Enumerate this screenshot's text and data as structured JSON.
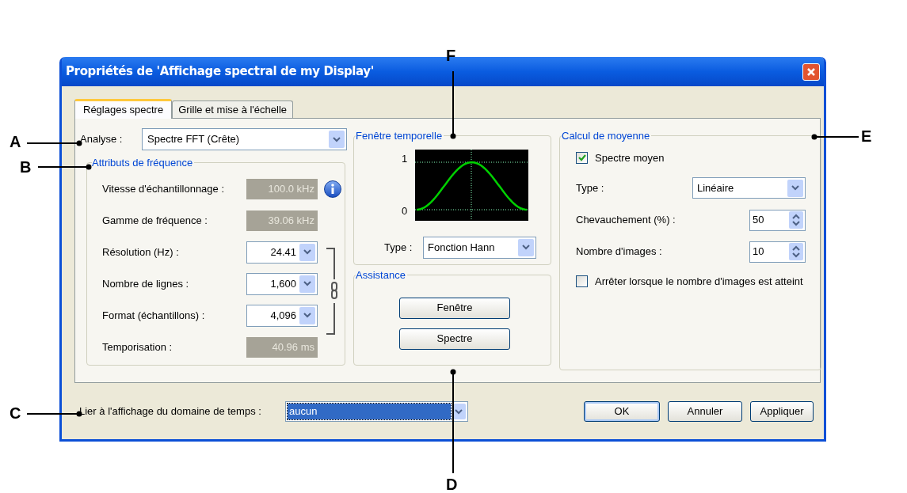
{
  "window": {
    "title": "Propriétés de 'Affichage spectral de my Display'"
  },
  "tabs": [
    {
      "label": "Réglages spectre",
      "selected": true
    },
    {
      "label": "Grille et mise à l'échelle",
      "selected": false
    }
  ],
  "analysis": {
    "label": "Analyse :",
    "value": "Spectre FFT (Crête)"
  },
  "frequency_attributes": {
    "title": "Attributs de fréquence",
    "rows": [
      {
        "label": "Vitesse d'échantillonnage :",
        "value": "100.0 kHz",
        "kind": "readonly",
        "info": true
      },
      {
        "label": "Gamme de fréquence :",
        "value": "39.06 kHz",
        "kind": "readonly",
        "info": false
      },
      {
        "label": "Résolution (Hz) :",
        "value": "24.41",
        "kind": "combo",
        "info": false
      },
      {
        "label": "Nombre de lignes :",
        "value": "1,600",
        "kind": "combo",
        "info": false
      },
      {
        "label": "Format (échantillons) :",
        "value": "4,096",
        "kind": "combo",
        "info": false
      },
      {
        "label": "Temporisation :",
        "value": "40.96 ms",
        "kind": "readonly",
        "info": false
      }
    ]
  },
  "time_window": {
    "title": "Fenêtre temporelle",
    "plot_labels": [
      "1",
      "0"
    ],
    "type_label": "Type :",
    "type_value": "Fonction Hann"
  },
  "assistance": {
    "title": "Assistance",
    "buttons": [
      "Fenêtre",
      "Spectre"
    ]
  },
  "averaging": {
    "title": "Calcul de moyenne",
    "items": [
      {
        "kind": "checkbox",
        "label": "Spectre moyen",
        "checked": true
      },
      {
        "kind": "combo",
        "label": "Type :",
        "value": "Linéaire"
      },
      {
        "kind": "spin",
        "label": "Chevauchement (%) :",
        "value": "50"
      },
      {
        "kind": "spin",
        "label": "Nombre d'images :",
        "value": "10"
      },
      {
        "kind": "checkbox",
        "label": "Arrêter lorsque le nombre d'images est atteint",
        "checked": false
      }
    ]
  },
  "link": {
    "label": "Lier à l'affichage du domaine de temps :",
    "value": "aucun",
    "focused": true
  },
  "buttons": [
    {
      "label": "OK",
      "default": true
    },
    {
      "label": "Annuler",
      "default": false
    },
    {
      "label": "Appliquer",
      "default": false
    }
  ],
  "callouts": [
    {
      "letter": "A"
    },
    {
      "letter": "B"
    },
    {
      "letter": "C"
    },
    {
      "letter": "D"
    },
    {
      "letter": "E"
    },
    {
      "letter": "F"
    }
  ]
}
